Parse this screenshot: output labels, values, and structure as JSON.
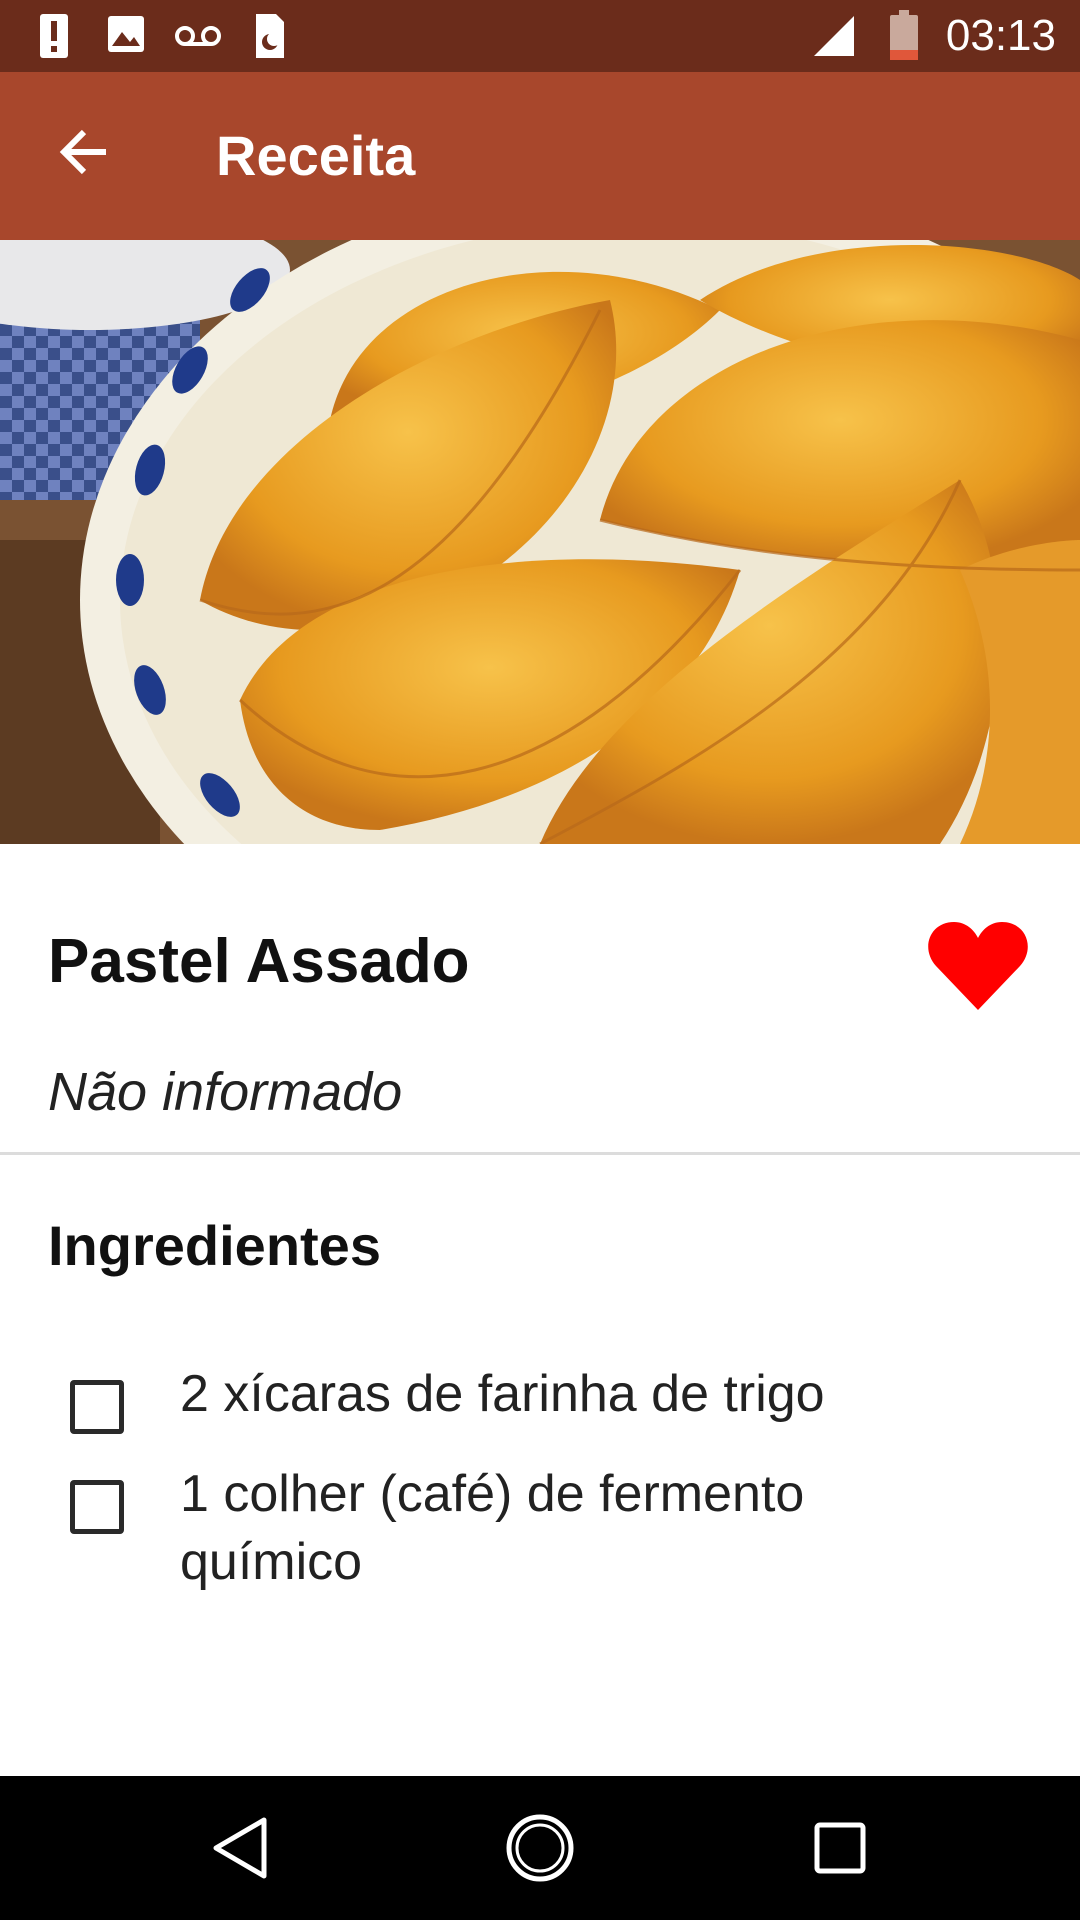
{
  "status_bar": {
    "time": "03:13",
    "left_icons": [
      "alert-icon",
      "image-icon",
      "voicemail-icon",
      "sim-moon-icon"
    ],
    "right_icons": [
      "signal-icon",
      "battery-icon"
    ]
  },
  "app_bar": {
    "title": "Receita",
    "back_icon": "arrow-back-icon"
  },
  "recipe": {
    "name": "Pastel Assado",
    "subtitle": "Não informado",
    "favorite_icon": "heart-icon",
    "favorite_color": "#ff0000"
  },
  "ingredients": {
    "title": "Ingredientes",
    "items": [
      {
        "label": "2 xícaras de farinha de trigo",
        "checked": false
      },
      {
        "label": "1 colher (café) de fermento químico",
        "checked": false
      }
    ]
  },
  "nav_bar": {
    "icons": [
      "back-triangle-icon",
      "home-circle-icon",
      "recents-square-icon"
    ]
  },
  "colors": {
    "status_bar": "#6b2c1b",
    "app_bar": "#a8472c",
    "accent": "#ff0000"
  }
}
